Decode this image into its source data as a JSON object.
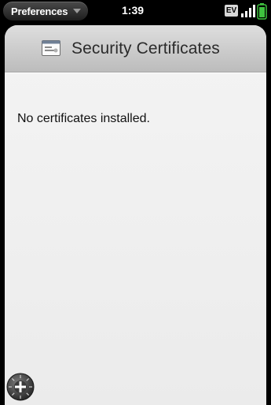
{
  "status_bar": {
    "app_menu_label": "Preferences",
    "time": "1:39",
    "network_type": "EV",
    "icons": [
      "menu-arrow-icon",
      "ev-network-icon",
      "signal-strength-icon",
      "battery-icon"
    ]
  },
  "header": {
    "title": "Security Certificates",
    "icon": "certificate-icon"
  },
  "main": {
    "empty_message": "No certificates installed."
  },
  "bottom": {
    "add_button_icon": "add-icon"
  },
  "colors": {
    "battery": "#3fc23f",
    "header_bg": "#cfcfcf",
    "card_bg": "#f1f1f1"
  }
}
